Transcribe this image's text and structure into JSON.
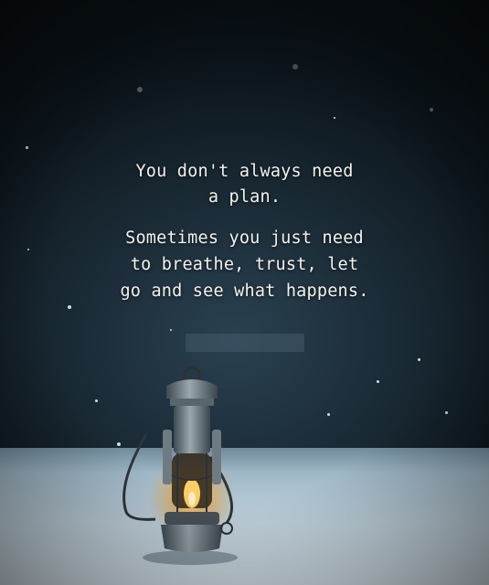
{
  "quote": {
    "line1": "You don't always need",
    "line2": "a plan.",
    "line3": "Sometimes you just need",
    "line4": "to breathe, trust, let",
    "line5": "go and see what happens."
  },
  "colors": {
    "sky": "#1a2a35",
    "snow": "#c3d5e0",
    "text": "#f2f2ee",
    "flame": "#f0a030"
  },
  "icons": {
    "lantern": "lantern-icon"
  }
}
